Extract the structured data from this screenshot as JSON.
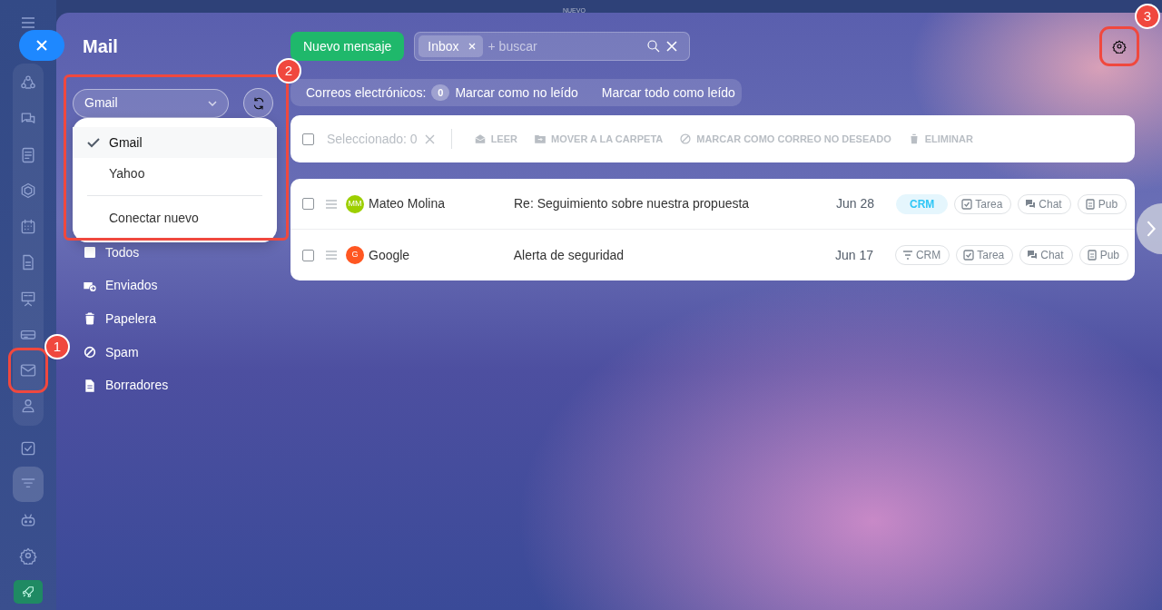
{
  "top_label": "NUEVO",
  "rail": {
    "groups": [
      {
        "kind": "pinned",
        "items": [
          {
            "selected": false
          },
          {
            "selected": false
          },
          {
            "selected": false
          },
          {
            "selected": false
          },
          {
            "selected": false
          },
          {
            "selected": false
          },
          {
            "selected": false
          },
          {
            "selected": false
          },
          {
            "selected": false
          },
          {
            "selected": false
          }
        ]
      },
      {
        "kind": "plain",
        "items": [
          {
            "selected": false
          },
          {
            "selected": true
          },
          {
            "selected": false
          },
          {
            "selected": false
          },
          {
            "selected": false
          }
        ]
      }
    ]
  },
  "panel": {
    "title": "Mail"
  },
  "mailbox_select": {
    "value": "Gmail",
    "expanded": true
  },
  "mailbox_menu": [
    {
      "label": "Gmail",
      "kind": "account",
      "selected": true
    },
    {
      "label": "Yahoo",
      "kind": "account",
      "selected": false
    },
    {
      "label": "Conectar nuevo",
      "kind": "action"
    }
  ],
  "folders": [
    {
      "label": "Todos",
      "kind": "all"
    },
    {
      "label": "Enviados",
      "kind": "sent"
    },
    {
      "label": "Papelera",
      "kind": "trash"
    },
    {
      "label": "Spam",
      "kind": "spam"
    },
    {
      "label": "Borradores",
      "kind": "drafts"
    }
  ],
  "new_button": "Nuevo mensaje",
  "search": {
    "filter_tag": "Inbox",
    "placeholder": "+ buscar"
  },
  "counter_bar": {
    "label": "Correos electrónicos:",
    "count": "0",
    "actions": [
      "Marcar como no leído",
      "Marcar todo como leído"
    ]
  },
  "toolbar": {
    "selected_label": "Seleccionado: 0",
    "checked": false,
    "actions": [
      {
        "label": "LEER",
        "kind": "read",
        "disabled": true
      },
      {
        "label": "MOVER A LA CARPETA",
        "kind": "move",
        "disabled": true
      },
      {
        "label": "MARCAR COMO CORREO NO DESEADO",
        "kind": "spam",
        "disabled": true
      },
      {
        "label": "ELIMINAR",
        "kind": "delete",
        "disabled": true
      }
    ]
  },
  "messages": [
    {
      "checked": false,
      "initials": "MM",
      "color": "#9dcf00",
      "sender": "Mateo Molina",
      "subject": "Re: Seguimiento sobre nuestra propuesta",
      "date": "Jun 28",
      "crm_added": true,
      "crm": "CRM",
      "tags": [
        "Tarea",
        "Chat",
        "Pub"
      ]
    },
    {
      "checked": false,
      "initials": "G",
      "color": "#ff5722",
      "sender": "Google",
      "subject": "Alerta de seguridad",
      "date": "Jun 17",
      "crm_added": false,
      "crm": "CRM",
      "tags": [
        "Tarea",
        "Chat",
        "Pub"
      ]
    }
  ],
  "callouts": [
    "1",
    "2",
    "3"
  ]
}
